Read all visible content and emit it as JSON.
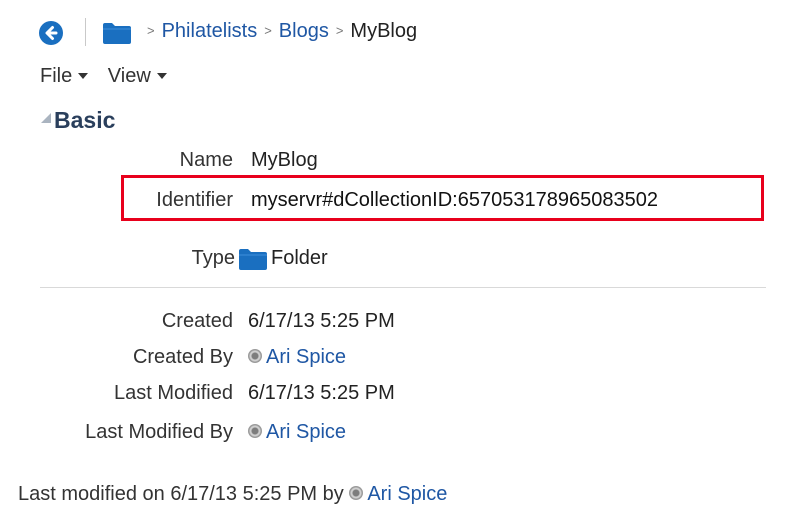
{
  "breadcrumb": {
    "items": [
      "Philatelists",
      "Blogs",
      "MyBlog"
    ],
    "separator": ">"
  },
  "menu": {
    "file": "File",
    "view": "View"
  },
  "section": {
    "title": "Basic"
  },
  "properties": {
    "name": {
      "label": "Name",
      "value": "MyBlog"
    },
    "identifier": {
      "label": "Identifier",
      "value": "myservr#dCollectionID:657053178965083502"
    },
    "type": {
      "label": "Type",
      "value": "Folder"
    },
    "created": {
      "label": "Created",
      "value": "6/17/13 5:25 PM"
    },
    "created_by": {
      "label": "Created By",
      "value": "Ari Spice"
    },
    "last_modified": {
      "label": "Last Modified",
      "value": "6/17/13 5:25 PM"
    },
    "last_modified_by": {
      "label": "Last Modified By",
      "value": "Ari Spice"
    }
  },
  "footer": {
    "prefix": "Last modified on 6/17/13 5:25 PM",
    "by": "by",
    "user": "Ari Spice"
  },
  "icons": {
    "back": "back-arrow-icon",
    "folder": "folder-icon",
    "user": "user-presence-icon"
  },
  "colors": {
    "link": "#1f57a4",
    "folder": "#1a6fc0",
    "highlight_box": "#e8001c",
    "section_title": "#2a3f5c"
  }
}
